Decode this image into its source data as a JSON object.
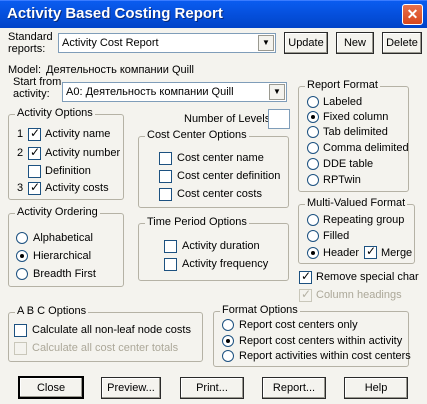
{
  "window": {
    "title": "Activity Based Costing Report",
    "close_glyph": "✕"
  },
  "standard_reports": {
    "label_line1": "Standard",
    "label_line2": "reports:",
    "value": "Activity Cost Report",
    "update_button": "Update",
    "new_button": "New",
    "delete_button": "Delete"
  },
  "model": {
    "label": "Model:",
    "value": "Деятельность компании Quill"
  },
  "start_from": {
    "label_line1": "Start from",
    "label_line2": "activity:",
    "value": "A0:  Деятельность компании Quill"
  },
  "activity_options": {
    "title": "Activity Options",
    "items": [
      {
        "order": "1",
        "label": "Activity name",
        "checked": true
      },
      {
        "order": "2",
        "label": "Activity number",
        "checked": true
      },
      {
        "order": "",
        "label": "Definition",
        "checked": false
      },
      {
        "order": "3",
        "label": "Activity costs",
        "checked": true
      }
    ]
  },
  "number_of_levels": {
    "label": "Number of Levels:",
    "value": ""
  },
  "cost_center_options": {
    "title": "Cost Center Options",
    "items": [
      {
        "label": "Cost center name",
        "checked": false
      },
      {
        "label": "Cost center definition",
        "checked": false
      },
      {
        "label": "Cost center costs",
        "checked": false
      }
    ]
  },
  "activity_ordering": {
    "title": "Activity Ordering",
    "options": [
      {
        "label": "Alphabetical",
        "selected": false
      },
      {
        "label": "Hierarchical",
        "selected": true
      },
      {
        "label": "Breadth First",
        "selected": false
      }
    ]
  },
  "time_period_options": {
    "title": "Time Period Options",
    "items": [
      {
        "label": "Activity duration",
        "checked": false
      },
      {
        "label": "Activity frequency",
        "checked": false
      }
    ]
  },
  "report_format": {
    "title": "Report Format",
    "options": [
      {
        "label": "Labeled",
        "selected": false
      },
      {
        "label": "Fixed column",
        "selected": true
      },
      {
        "label": "Tab delimited",
        "selected": false
      },
      {
        "label": "Comma delimited",
        "selected": false
      },
      {
        "label": "DDE table",
        "selected": false
      },
      {
        "label": "RPTwin",
        "selected": false
      }
    ]
  },
  "multi_valued_format": {
    "title": "Multi-Valued Format",
    "options": [
      {
        "label": "Repeating group",
        "selected": false
      },
      {
        "label": "Filled",
        "selected": false
      },
      {
        "label": "Header",
        "selected": true
      }
    ],
    "merge_label": "Merge",
    "merge_checked": true
  },
  "remove_special_char": {
    "label": "Remove special char",
    "checked": true
  },
  "column_headings": {
    "label": "Column headings",
    "checked": true,
    "disabled": true
  },
  "abc_options": {
    "title": "A B C  Options",
    "items": [
      {
        "label": "Calculate all non-leaf node costs",
        "checked": false,
        "disabled": false
      },
      {
        "label": "Calculate all cost center totals",
        "checked": false,
        "disabled": true
      }
    ]
  },
  "format_options": {
    "title": "Format Options",
    "options": [
      {
        "label": "Report cost centers only",
        "selected": false
      },
      {
        "label": "Report cost centers within activity",
        "selected": true
      },
      {
        "label": "Report activities within cost centers",
        "selected": false
      }
    ]
  },
  "footer": {
    "close": "Close",
    "preview": "Preview...",
    "print": "Print...",
    "report": "Report...",
    "help": "Help"
  },
  "colors": {
    "titlebar": "#0054e3",
    "face": "#f4f3ee",
    "close_button": "#d8471c"
  }
}
